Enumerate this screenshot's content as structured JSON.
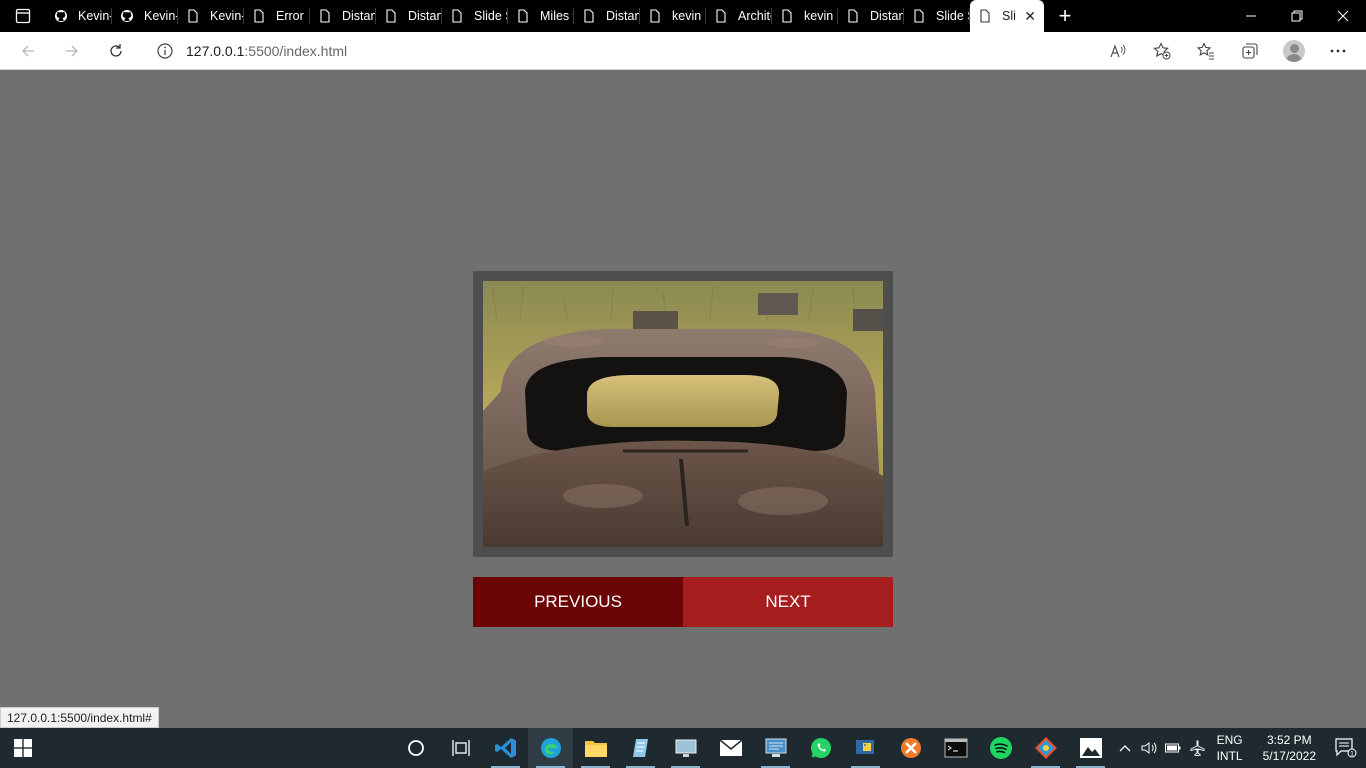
{
  "browser": {
    "tabs": [
      {
        "label": "Kevin-(",
        "icon": "github-icon"
      },
      {
        "label": "Kevin-(",
        "icon": "github-icon"
      },
      {
        "label": "Kevin-(",
        "icon": "page-icon"
      },
      {
        "label": "Error",
        "icon": "page-icon"
      },
      {
        "label": "Distanc",
        "icon": "page-icon"
      },
      {
        "label": "Distanc",
        "icon": "page-icon"
      },
      {
        "label": "Slide S",
        "icon": "page-icon"
      },
      {
        "label": "Miles t",
        "icon": "page-icon"
      },
      {
        "label": "Distanc",
        "icon": "page-icon"
      },
      {
        "label": "kevin",
        "icon": "page-icon"
      },
      {
        "label": "Archite",
        "icon": "page-icon"
      },
      {
        "label": "kevin",
        "icon": "page-icon"
      },
      {
        "label": "Distanc",
        "icon": "page-icon"
      },
      {
        "label": "Slide S",
        "icon": "page-icon"
      }
    ],
    "active_tab": {
      "label": "Sli",
      "icon": "page-icon"
    },
    "url_host": "127.0.0.1",
    "url_path": ":5500/index.html",
    "status_url": "127.0.0.1:5500/index.html#"
  },
  "slider": {
    "prev_label": "PREVIOUS",
    "next_label": "NEXT"
  },
  "taskbar": {
    "lang_line1": "ENG",
    "lang_line2": "INTL",
    "time": "3:52 PM",
    "date": "5/17/2022",
    "notification_count": "1"
  },
  "colors": {
    "page_bg": "#707070",
    "frame_bg": "#4e4e4e",
    "prev_bg": "#6b0404",
    "next_bg": "#a51d1d"
  }
}
